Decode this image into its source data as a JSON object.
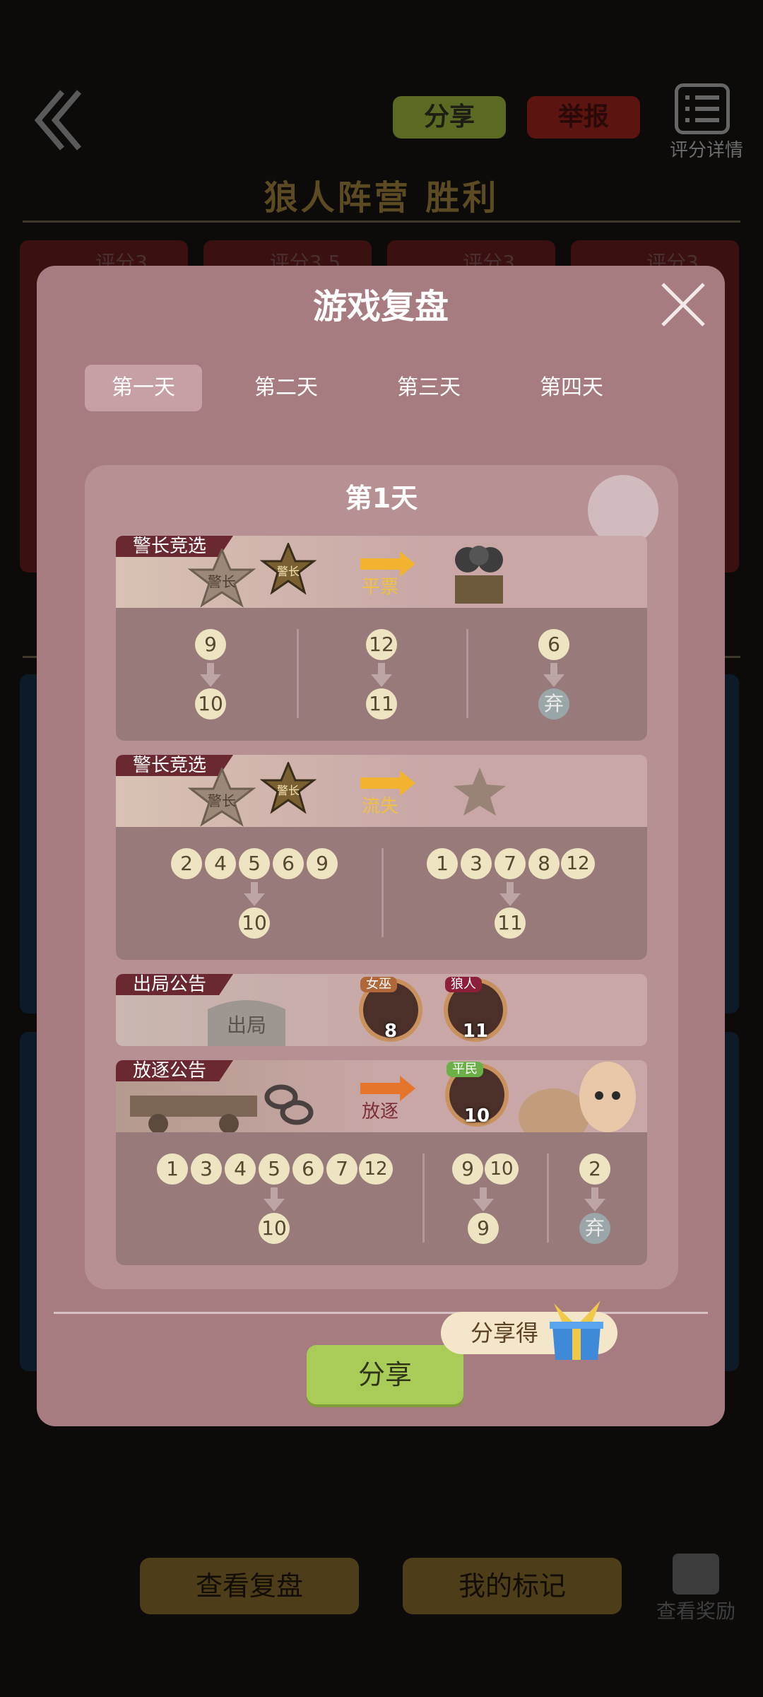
{
  "background": {
    "share_label": "分享",
    "report_label": "举报",
    "detail_label": "评分详情",
    "result_title": "狼人阵营  胜利",
    "player_cards": [
      {
        "score": "评分3"
      },
      {
        "score": "评分3.5"
      },
      {
        "score": "评分3"
      },
      {
        "score": "评分3"
      }
    ],
    "view_replay_label": "查看复盘",
    "my_marks_label": "我的标记",
    "view_rewards_label": "查看奖励"
  },
  "modal": {
    "title": "游戏复盘",
    "tabs": [
      {
        "label": "第一天",
        "active": true
      },
      {
        "label": "第二天",
        "active": false
      },
      {
        "label": "第三天",
        "active": false
      },
      {
        "label": "第四天",
        "active": false
      }
    ],
    "day_title": "第1天",
    "sections": {
      "sheriff1": {
        "tag": "警长竞选",
        "badge_left": "警长",
        "badge_right": "警长",
        "result": "平票",
        "votes": [
          {
            "from": "9",
            "to": "10"
          },
          {
            "from": "12",
            "to": "11"
          },
          {
            "from": "6",
            "to": "弃"
          }
        ]
      },
      "sheriff2": {
        "tag": "警长竞选",
        "badge_left": "警长",
        "badge_right": "警长",
        "result": "流失",
        "groups": [
          {
            "from": [
              "2",
              "4",
              "5",
              "6",
              "9"
            ],
            "to": "10"
          },
          {
            "from": [
              "1",
              "3",
              "7",
              "8",
              "12"
            ],
            "to": "11"
          }
        ]
      },
      "out": {
        "tag": "出局公告",
        "stone": "出局",
        "players": [
          {
            "role": "女巫",
            "number": "8",
            "role_color": "#b0683a"
          },
          {
            "role": "狼人",
            "number": "11",
            "role_color": "#8d1f3a"
          }
        ]
      },
      "exile": {
        "tag": "放逐公告",
        "result": "放逐",
        "player": {
          "role": "平民",
          "number": "10",
          "role_color": "#6bb047"
        },
        "groups": [
          {
            "from": [
              "1",
              "3",
              "4",
              "5",
              "6",
              "7",
              "12"
            ],
            "to": "10"
          },
          {
            "from": [
              "9",
              "10"
            ],
            "to": "9"
          },
          {
            "from": [
              "2"
            ],
            "to": "弃"
          }
        ]
      }
    },
    "share_button": "分享",
    "share_reward": "分享得"
  },
  "colors": {
    "modal_bg": "#a67c81",
    "panel_bg": "#b79094",
    "accent_gold": "#f2b430",
    "accent_orange": "#e4752b",
    "share_green": "#a9cc58",
    "tag_bg": "#6a2830"
  }
}
